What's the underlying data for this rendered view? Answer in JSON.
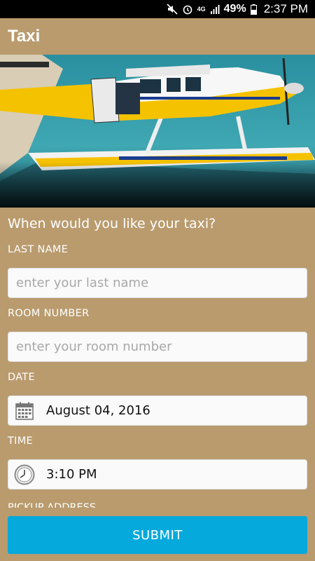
{
  "status_bar": {
    "network": "4G",
    "battery": "49%",
    "time": "2:37 PM"
  },
  "app_bar": {
    "title": "Taxi"
  },
  "hero": {
    "image": "seaplane-on-water"
  },
  "form": {
    "question": "When would you like your taxi?",
    "last_name": {
      "label": "LAST NAME",
      "placeholder": "enter your last name",
      "value": ""
    },
    "room_number": {
      "label": "ROOM NUMBER",
      "placeholder": "enter your room number",
      "value": ""
    },
    "date": {
      "label": "DATE",
      "value": "August 04, 2016",
      "icon": "calendar-icon"
    },
    "time": {
      "label": "TIME",
      "value": "3:10 PM",
      "icon": "clock-icon"
    },
    "next_label": "PICKUP ADDRESS"
  },
  "submit": {
    "label": "SUBMIT",
    "color": "#06a9dc"
  },
  "colors": {
    "background": "#b99b6e",
    "accent": "#06a9dc"
  }
}
